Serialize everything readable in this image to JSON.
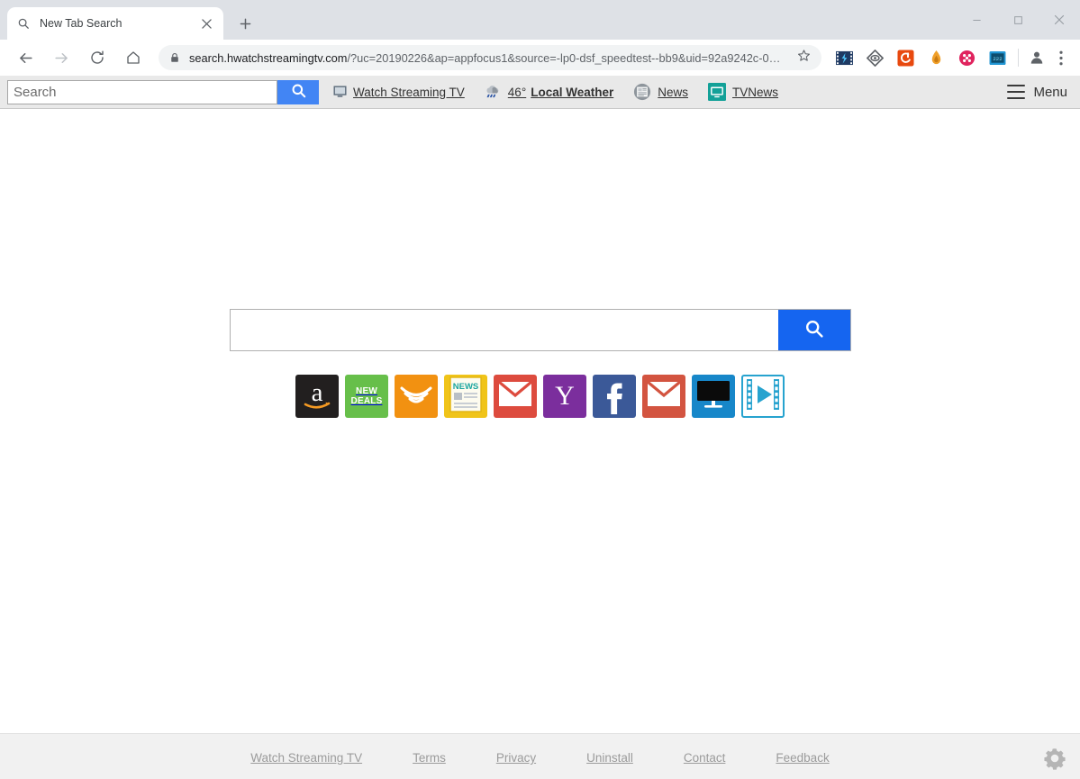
{
  "browser": {
    "tab": {
      "title": "New Tab Search",
      "favicon": "search-icon",
      "close": "×"
    },
    "new_tab_button": "+",
    "window_controls": {
      "minimize": "—",
      "maximize": "□",
      "close": "✕"
    },
    "nav": {
      "back": "back-arrow-icon",
      "forward": "forward-arrow-icon",
      "reload": "reload-icon",
      "home": "home-icon"
    },
    "omnibox": {
      "lock": "lock-icon",
      "host": "search.hwatchstreamingtv.com",
      "path": "/?uc=20190226&ap=appfocus1&source=-lp0-dsf_speedtest--bb9&uid=92a9242c-0…",
      "bookmark_star": "star-icon"
    },
    "extensions": [
      {
        "name": "video-downloader-extension",
        "color": "#1f3a63"
      },
      {
        "name": "adblock-extension",
        "color": "#5f6368"
      },
      {
        "name": "orange-shield-extension",
        "color": "#e8490f"
      },
      {
        "name": "honey-extension",
        "color": "#f0a02a"
      },
      {
        "name": "pink-circle-extension",
        "color": "#e0245e"
      },
      {
        "name": "screen-recorder-extension",
        "color": "#2196d4"
      }
    ],
    "profile": "avatar-icon",
    "chrome_menu": "three-dots-icon"
  },
  "searchbar": {
    "input_value": "",
    "input_placeholder": "Search",
    "go_icon": "search-icon",
    "links": [
      {
        "name": "watch-streaming-tv",
        "icon": "monitor-icon",
        "label": "Watch Streaming TV"
      },
      {
        "name": "local-weather",
        "icon": "cloud-rain-icon",
        "temp": "46°",
        "label": "Local Weather"
      },
      {
        "name": "news",
        "icon": "newspaper-icon",
        "label": "News"
      },
      {
        "name": "tv-news",
        "icon": "tv-icon",
        "label": "TVNews"
      }
    ],
    "menu": {
      "icon": "hamburger-icon",
      "label": "Menu"
    }
  },
  "main": {
    "search": {
      "value": "",
      "placeholder": "",
      "go_icon": "search-icon"
    },
    "tiles": [
      {
        "name": "amazon-tile",
        "label": "amazon",
        "icon": "amazon-icon",
        "bg": "#221f1f"
      },
      {
        "name": "new-deals-tile",
        "label": "NEW DEALS",
        "icon": "new-deals-icon",
        "bg": "#67bf4a"
      },
      {
        "name": "audible-tile",
        "label": "Audible",
        "icon": "audible-icon",
        "bg": "#f29111"
      },
      {
        "name": "news-tile",
        "label": "NEWS",
        "icon": "news-page-icon",
        "bg": "#f0c419"
      },
      {
        "name": "gmail-tile",
        "label": "Gmail",
        "icon": "envelope-icon",
        "bg": "#dd4b3e"
      },
      {
        "name": "yahoo-tile",
        "label": "Yahoo",
        "icon": "yahoo-y-icon",
        "bg": "#7b2e9d"
      },
      {
        "name": "facebook-tile",
        "label": "Facebook",
        "icon": "facebook-f-icon",
        "bg": "#3b5998"
      },
      {
        "name": "mail-tile",
        "label": "Mail",
        "icon": "envelope-icon",
        "bg": "#d35440"
      },
      {
        "name": "tv-monitor-tile",
        "label": "TV",
        "icon": "monitor-icon",
        "bg": "#1787c9"
      },
      {
        "name": "video-tile",
        "label": "Video",
        "icon": "film-play-icon",
        "bg": "#ffffff"
      }
    ]
  },
  "footer": {
    "links": [
      "Watch Streaming TV",
      "Terms",
      "Privacy",
      "Uninstall",
      "Contact",
      "Feedback"
    ],
    "settings_icon": "gear-icon"
  }
}
